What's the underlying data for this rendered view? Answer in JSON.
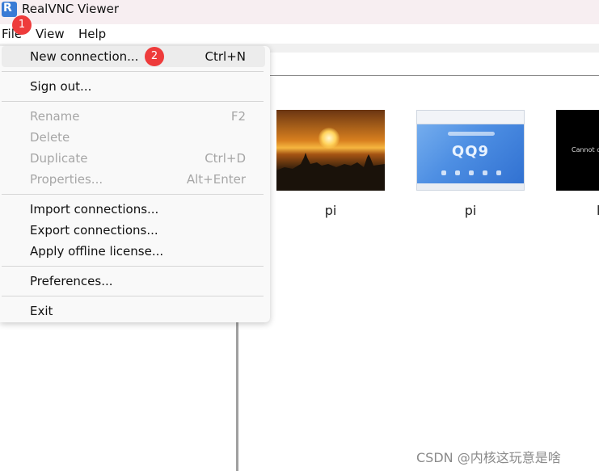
{
  "window": {
    "title": "RealVNC Viewer"
  },
  "menubar": {
    "file": "File",
    "view": "View",
    "help": "Help"
  },
  "file_menu": {
    "new_connection": {
      "label": "New connection...",
      "shortcut": "Ctrl+N"
    },
    "sign_out": {
      "label": "Sign out..."
    },
    "rename": {
      "label": "Rename",
      "shortcut": "F2"
    },
    "delete": {
      "label": "Delete"
    },
    "duplicate": {
      "label": "Duplicate",
      "shortcut": "Ctrl+D"
    },
    "properties": {
      "label": "Properties...",
      "shortcut": "Alt+Enter"
    },
    "import_connections": {
      "label": "Import connections..."
    },
    "export_connections": {
      "label": "Export connections..."
    },
    "apply_license": {
      "label": "Apply offline license..."
    },
    "preferences": {
      "label": "Preferences..."
    },
    "exit": {
      "label": "Exit"
    }
  },
  "annotations": {
    "step1": "1",
    "step2": "2"
  },
  "connections": [
    {
      "name": "pi"
    },
    {
      "name": "pi",
      "thumb_text": "QQ9"
    },
    {
      "name": "l",
      "thumb_text": "Cannot cu"
    }
  ],
  "watermark": "CSDN @内核这玩意是啥",
  "colors": {
    "badge": "#ee3b3b",
    "titlebar": "#f7eef1"
  }
}
